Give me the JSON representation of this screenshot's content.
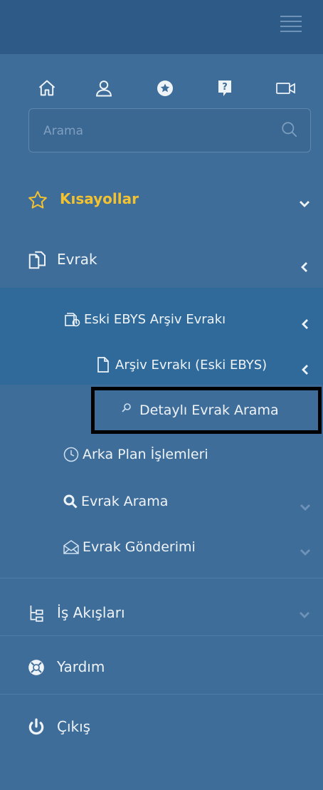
{
  "search": {
    "placeholder": "Arama"
  },
  "menu": {
    "shortcuts": "Kısayollar",
    "evrak": "Evrak",
    "eski_ebys": "Eski EBYS Arşiv Evrakı",
    "arsiv_evraki": "Arşiv Evrakı (Eski EBYS)",
    "detayli_arama": "Detaylı Evrak Arama",
    "arka_plan": "Arka Plan İşlemleri",
    "evrak_arama": "Evrak Arama",
    "evrak_gonderimi": "Evrak Gönderimi",
    "is_akislari": "İş Akışları",
    "yardim": "Yardım",
    "cikis": "Çıkış"
  },
  "colors": {
    "accent_yellow": "#f2c230",
    "sidebar_bg": "#3f6d99",
    "topbar_bg": "#2d5a87",
    "submenu_bg": "#2f6a9a"
  },
  "icons": [
    "home-icon",
    "user-icon",
    "star-circle-icon",
    "help-icon",
    "video-icon",
    "search-icon",
    "star-outline-icon",
    "documents-icon",
    "history-doc-icon",
    "file-icon",
    "magnifier-icon",
    "clock-icon",
    "search-bold-icon",
    "envelope-icon",
    "workflow-icon",
    "lifebuoy-icon",
    "power-icon"
  ]
}
